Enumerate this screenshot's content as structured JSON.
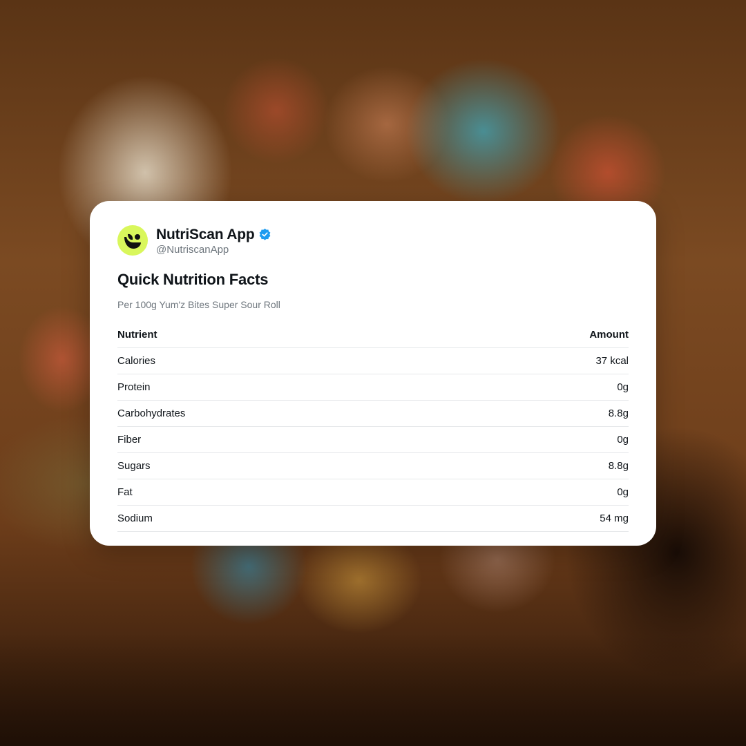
{
  "account": {
    "name": "NutriScan App",
    "handle": "@NutriscanApp",
    "verified": true,
    "avatar_color": "#d9f75c",
    "avatar_icon": "leaf-logo-icon",
    "verified_badge_color": "#1d9bf0"
  },
  "post": {
    "title": "Quick Nutrition Facts",
    "subtitle": "Per 100g Yum'z Bites Super Sour Roll"
  },
  "table": {
    "headers": [
      "Nutrient",
      "Amount"
    ],
    "rows": [
      {
        "nutrient": "Calories",
        "amount": "37 kcal"
      },
      {
        "nutrient": "Protein",
        "amount": "0g"
      },
      {
        "nutrient": "Carbohydrates",
        "amount": "8.8g"
      },
      {
        "nutrient": "Fiber",
        "amount": "0g"
      },
      {
        "nutrient": "Sugars",
        "amount": "8.8g"
      },
      {
        "nutrient": "Fat",
        "amount": "0g"
      },
      {
        "nutrient": "Sodium",
        "amount": "54 mg"
      }
    ]
  }
}
